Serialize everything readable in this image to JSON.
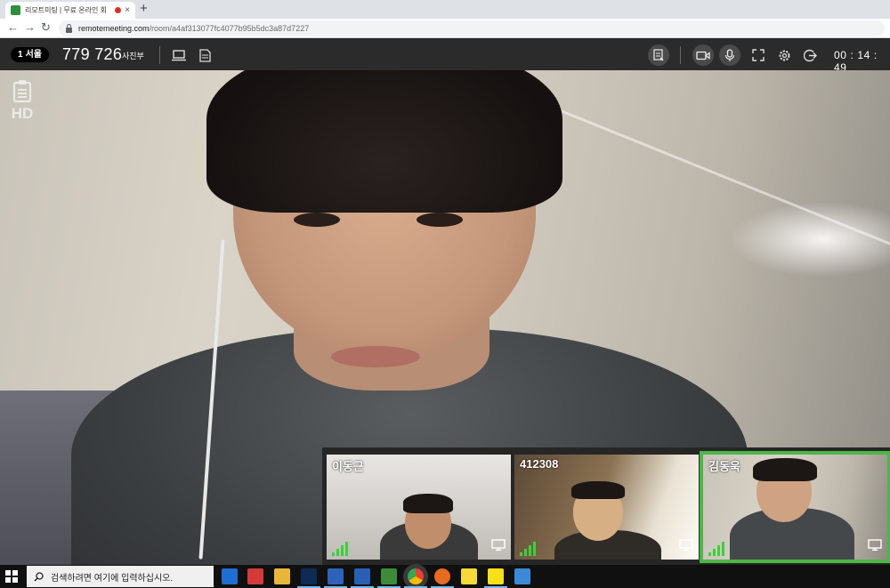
{
  "browser": {
    "tab_title": "리모트미팅 | 무료 온라인 회",
    "tab_close": "×",
    "new_tab": "+",
    "url_host": "remotemeeting.com",
    "url_path": "/room/a4af313077fc4077b95b5dc3a87d7227",
    "nav_back": "←",
    "nav_forward": "→",
    "nav_reload": "↻"
  },
  "appbar": {
    "location_count": "1",
    "location_name": "서울",
    "room_number": "779 726",
    "room_label": "사진부",
    "timer": "00 : 14 : 49"
  },
  "main_video": {
    "quality_badge": "HD"
  },
  "participants": [
    {
      "name": "이동근",
      "signal_bars": 4,
      "active": false
    },
    {
      "name": "412308",
      "signal_bars": 4,
      "active": false
    },
    {
      "name": "김동욱",
      "signal_bars": 4,
      "active": true
    }
  ],
  "colors": {
    "active_border": "#4cb748",
    "signal": "#3bd13b",
    "appbar_bg": "#2b2b2b"
  },
  "taskbar": {
    "search_placeholder": "검색하려면 여기에 입력하십시오.",
    "apps": [
      "edge-icon",
      "camera-app-icon",
      "file-explorer-icon",
      "photoshop-icon",
      "calculator-icon",
      "notepad-icon",
      "maps-icon",
      "chrome-icon",
      "firefox-icon",
      "sticky-notes-icon",
      "kakaotalk-icon",
      "remote-desktop-icon"
    ]
  }
}
